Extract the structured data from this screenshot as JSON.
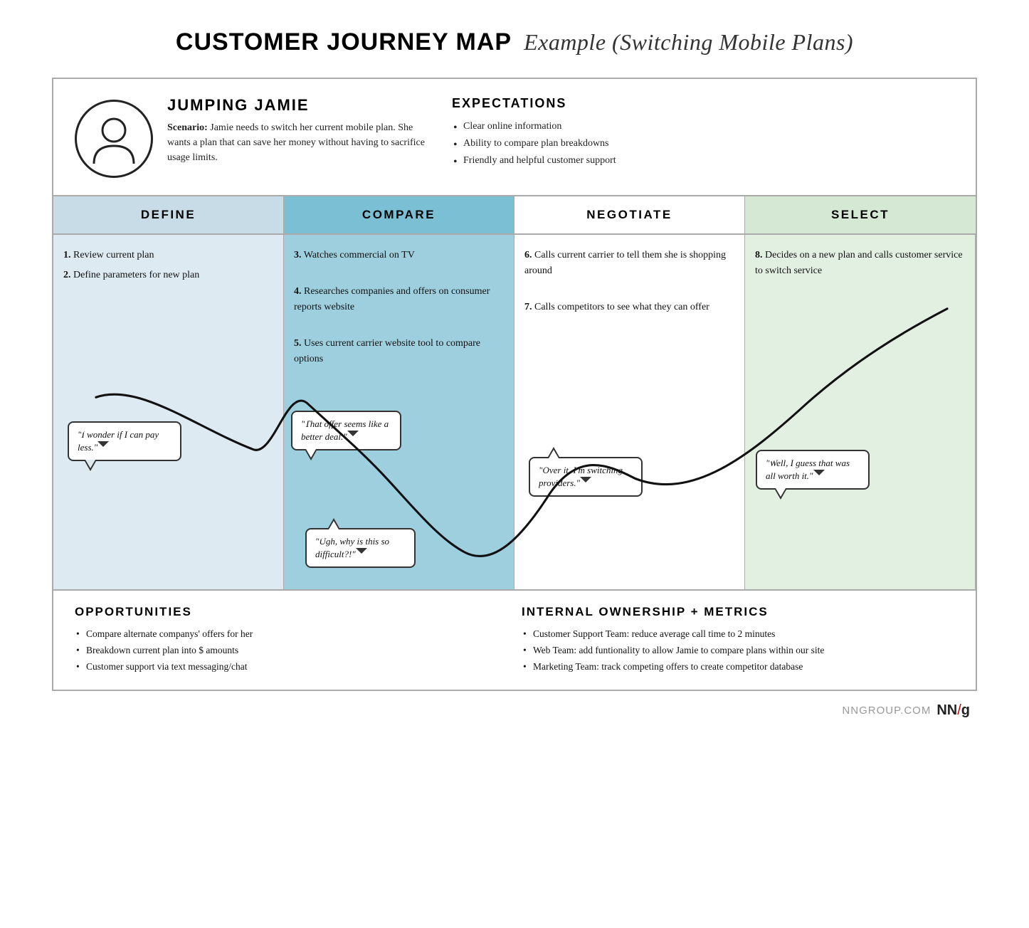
{
  "title": {
    "bold": "CUSTOMER JOURNEY MAP",
    "italic": "Example (Switching Mobile Plans)"
  },
  "persona": {
    "name": "JUMPING JAMIE",
    "scenario_label": "Scenario:",
    "scenario_text": "Jamie needs to switch her current mobile plan. She wants a plan that can save her money without having to sacrifice usage limits."
  },
  "expectations": {
    "title": "EXPECTATIONS",
    "items": [
      "Clear online information",
      "Ability to compare plan breakdowns",
      "Friendly and helpful customer support"
    ]
  },
  "stages": {
    "define": "DEFINE",
    "compare": "COMPARE",
    "negotiate": "NEGOTIATE",
    "select": "SELECT"
  },
  "journey": {
    "define": {
      "steps": [
        "1. Review current plan",
        "2. Define parameters for new plan"
      ],
      "bubble": "\"I wonder if I can pay less.\""
    },
    "compare": {
      "steps": [
        "3. Watches commercial on TV",
        "4. Researches companies and offers on consumer reports website",
        "5. Uses current carrier website tool to compare options"
      ],
      "bubble1": "\"That offer seems like a better deal.\"",
      "bubble2": "\"Ugh, why is this so difficult?!\""
    },
    "negotiate": {
      "steps": [
        "6. Calls current carrier to tell them she is shopping around",
        "7. Calls competitors to see what they can offer"
      ],
      "bubble": "\"Over it. I'm switching providers.\""
    },
    "select": {
      "steps": [
        "8. Decides on a new plan and calls customer service to switch service"
      ],
      "bubble": "\"Well, I guess that was all worth it.\""
    }
  },
  "opportunities": {
    "title": "OPPORTUNITIES",
    "items": [
      "Compare alternate companys' offers for her",
      "Breakdown current plan into $ amounts",
      "Customer support via text messaging/chat"
    ]
  },
  "internal": {
    "title": "INTERNAL OWNERSHIP + METRICS",
    "items": [
      "Customer Support Team: reduce average call time to 2 minutes",
      "Web Team: add funtionality to allow Jamie to compare plans within our site",
      "Marketing Team: track competing offers to create competitor database"
    ]
  },
  "branding": {
    "text": "NNGROUP.COM",
    "logo": "NN/g"
  }
}
